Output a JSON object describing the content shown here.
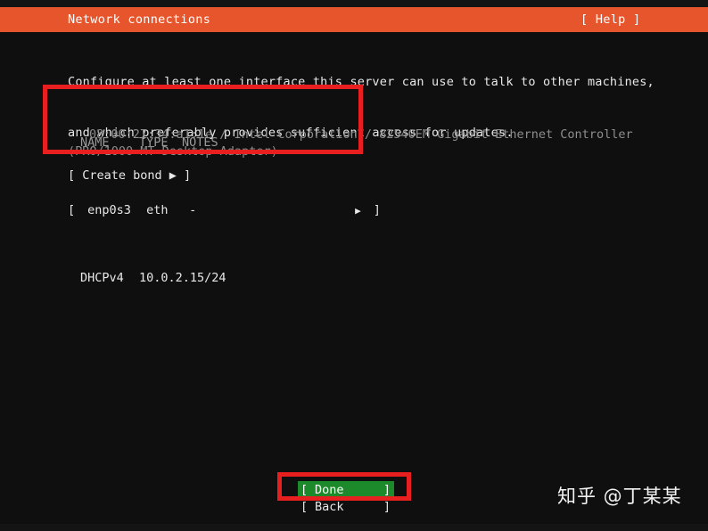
{
  "window": {
    "title": "Network connections",
    "help_label": "[ Help ]"
  },
  "intro": {
    "line1": "Configure at least one interface this server can use to talk to other machines,",
    "line2": "and which preferably provides sufficient access for updates."
  },
  "table": {
    "headers": {
      "name": "NAME",
      "type": "TYPE",
      "notes": "NOTES"
    },
    "rows": [
      {
        "open_bracket": "[",
        "name": "enp0s3",
        "type": "eth",
        "notes": "-",
        "arrow": "▶",
        "close_bracket": "]",
        "detail_proto": "DHCPv4",
        "detail_address": "10.0.2.15/24",
        "hardware_line1": "08:00:27:34:a1:1e / Intel Corporation / 82540EM Gigabit Ethernet Controller",
        "hardware_line2": "(PRO/1000 MT Desktop Adapter)"
      }
    ]
  },
  "actions": {
    "create_bond": "[ Create bond ▶ ]"
  },
  "footer": {
    "done": {
      "open_bracket": "[",
      "label": "Done",
      "close_bracket": "]"
    },
    "back": {
      "open_bracket": "[",
      "label": "Back",
      "close_bracket": "]"
    }
  },
  "watermark": {
    "text": "知乎 @丁某某"
  },
  "colors": {
    "header_bg": "#e6552c",
    "selection_bg": "#1c8a2a",
    "annotation": "#e81f1f",
    "terminal_bg": "#0f0f0f",
    "text": "#e8e8e8",
    "dim_text": "#8e8e8e"
  }
}
